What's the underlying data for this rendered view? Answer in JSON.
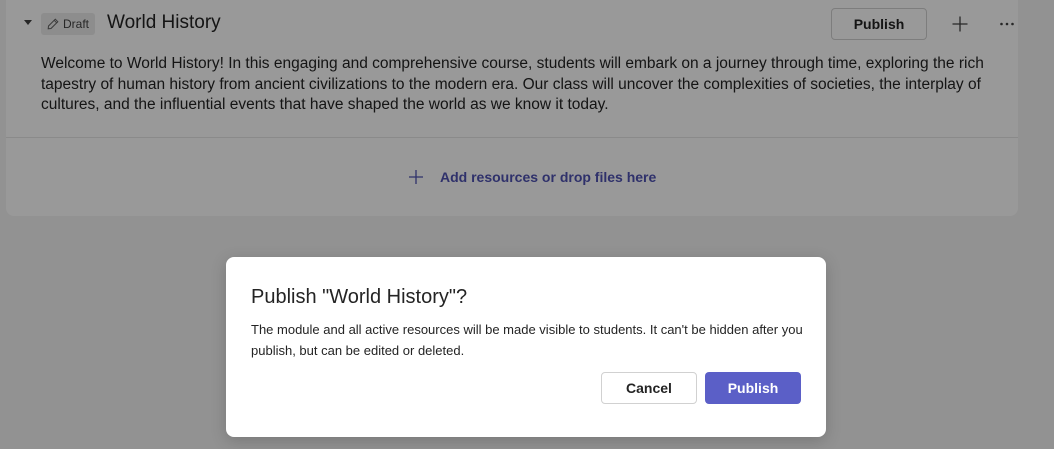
{
  "module": {
    "badge_label": "Draft",
    "title": "World History",
    "publish_label": "Publish",
    "description": "Welcome to World History! In this engaging and comprehensive course, students will embark on a journey through time, exploring the rich tapestry of human history from ancient civilizations to the modern era. Our class will uncover the complexities of societies, the interplay of cultures, and the influential events that have shaped the world as we know it today.",
    "add_resources_label": "Add resources or drop files here"
  },
  "icons": {
    "caret": "chevron-down-icon",
    "badge": "pencil-icon",
    "add": "plus-icon",
    "more": "more-horizontal-icon",
    "add_resources": "plus-icon"
  },
  "dialog": {
    "title": "Publish \"World History\"?",
    "body": "The module and all active resources will be made visible to students. It can't be hidden after you publish, but can be edited or deleted.",
    "cancel_label": "Cancel",
    "confirm_label": "Publish"
  },
  "colors": {
    "brand": "#5b5fc7",
    "link": "#4f52b2",
    "overlay": "rgba(0,0,0,0.40)"
  }
}
